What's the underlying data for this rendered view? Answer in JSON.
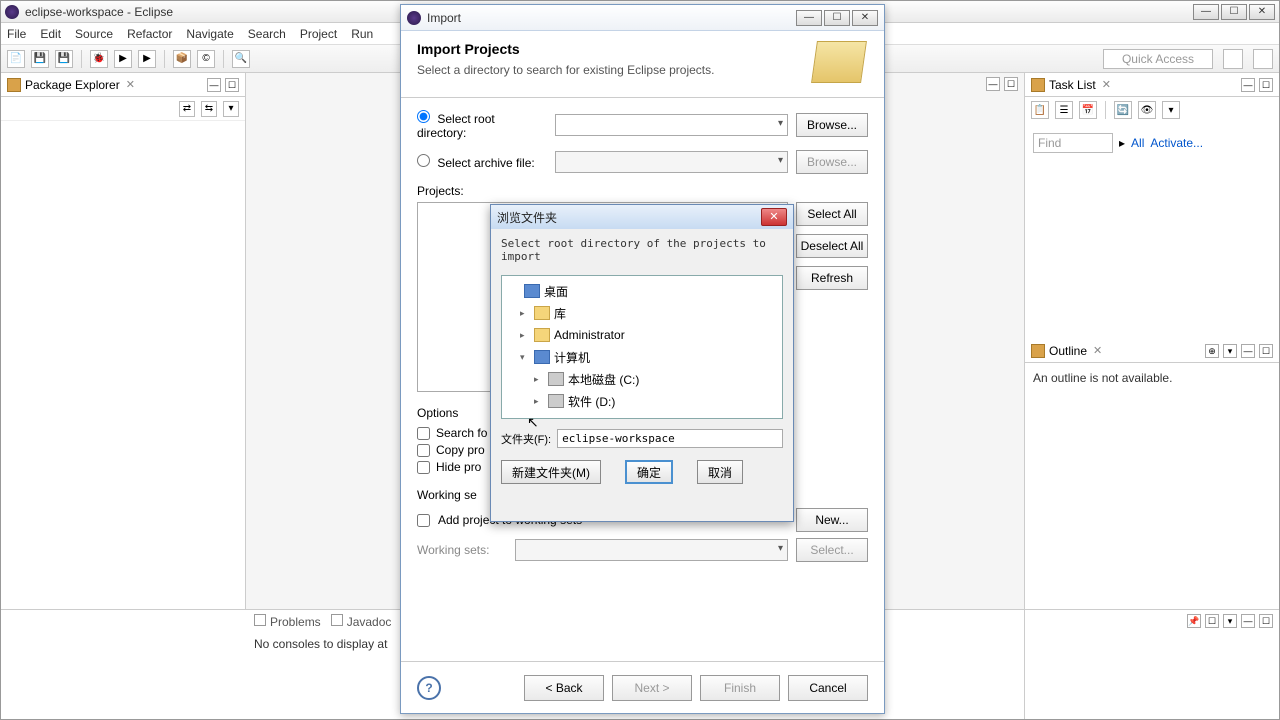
{
  "eclipse": {
    "title": "eclipse-workspace - Eclipse",
    "menus": [
      "File",
      "Edit",
      "Source",
      "Refactor",
      "Navigate",
      "Search",
      "Project",
      "Run",
      "..."
    ],
    "quick_access": "Quick Access"
  },
  "package_explorer": {
    "title": "Package Explorer"
  },
  "task_list": {
    "title": "Task List",
    "find": "Find",
    "all": "All",
    "activate": "Activate..."
  },
  "outline": {
    "title": "Outline",
    "empty": "An outline is not available."
  },
  "console": {
    "tabs": {
      "problems": "Problems",
      "javadoc": "Javadoc"
    },
    "empty": "No consoles to display at"
  },
  "import_dialog": {
    "title": "Import",
    "heading": "Import Projects",
    "subheading": "Select a directory to search for existing Eclipse projects.",
    "root_dir_label": "Select root directory:",
    "archive_label": "Select archive file:",
    "browse": "Browse...",
    "projects_label": "Projects:",
    "select_all": "Select All",
    "deselect_all": "Deselect All",
    "refresh": "Refresh",
    "options_label": "Options",
    "search_nested": "Search fo",
    "copy_projects": "Copy pro",
    "hide_projects": "Hide pro",
    "working_sets_header": "Working se",
    "add_to_ws": "Add project to working sets",
    "new_btn": "New...",
    "ws_label": "Working sets:",
    "select_btn": "Select...",
    "back": "< Back",
    "next": "Next >",
    "finish": "Finish",
    "cancel": "Cancel"
  },
  "browse_dialog": {
    "title": "浏览文件夹",
    "message": "Select root directory of the projects to import",
    "tree": {
      "desktop": "桌面",
      "libraries": "库",
      "admin": "Administrator",
      "computer": "计算机",
      "drive_c": "本地磁盘 (C:)",
      "drive_d": "软件 (D:)"
    },
    "folder_label": "文件夹(F):",
    "folder_value": "eclipse-workspace",
    "new_folder": "新建文件夹(M)",
    "ok": "确定",
    "cancel": "取消"
  }
}
